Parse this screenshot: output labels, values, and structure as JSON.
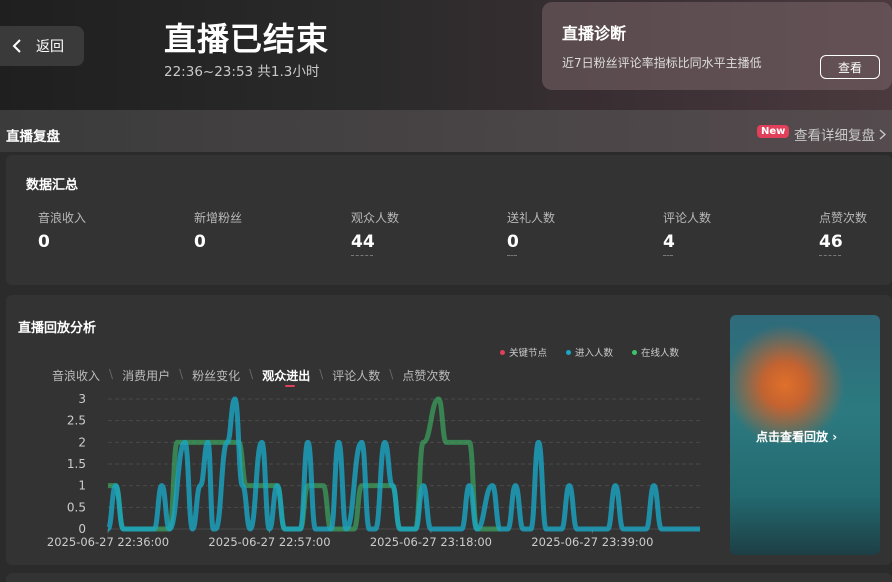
{
  "header": {
    "back_label": "返回",
    "title": "直播已结束",
    "time_range": "22:36~23:53 共1.3小时"
  },
  "diagnosis": {
    "title": "直播诊断",
    "description": "近7日粉丝评论率指标比同水平主播低",
    "button_label": "查看"
  },
  "review": {
    "section_title": "直播复盘",
    "new_badge": "New",
    "detail_link": "查看详细复盘"
  },
  "summary": {
    "title": "数据汇总",
    "stats": [
      {
        "label": "音浪收入",
        "value": "0"
      },
      {
        "label": "新增粉丝",
        "value": "0"
      },
      {
        "label": "观众人数",
        "value": "44"
      },
      {
        "label": "送礼人数",
        "value": "0"
      },
      {
        "label": "评论人数",
        "value": "4"
      },
      {
        "label": "点赞次数",
        "value": "46"
      }
    ]
  },
  "analysis": {
    "title": "直播回放分析",
    "legend": [
      {
        "label": "关键节点",
        "color": "#e0405a"
      },
      {
        "label": "进入人数",
        "color": "#1aa6c4"
      },
      {
        "label": "在线人数",
        "color": "#3ec36b"
      }
    ],
    "tabs": [
      "音浪收入",
      "消费用户",
      "粉丝变化",
      "观众进出",
      "评论人数",
      "点赞次数"
    ],
    "active_tab": "观众进出",
    "replay_label": "点击查看回放"
  },
  "chart_data": {
    "type": "line",
    "ylim": [
      0,
      3
    ],
    "yticks": [
      "0",
      "0.5",
      "1",
      "1.5",
      "2",
      "2.5",
      "3"
    ],
    "xticks": [
      "2025-06-27 22:36:00",
      "2025-06-27 22:57:00",
      "2025-06-27 23:18:00",
      "2025-06-27 23:39:00"
    ],
    "x_range_minutes": [
      0,
      77
    ],
    "series": [
      {
        "name": "进入人数",
        "color": "#1aa6c4",
        "points": [
          [
            0,
            0
          ],
          [
            1,
            1
          ],
          [
            2,
            0
          ],
          [
            6,
            0
          ],
          [
            7,
            1
          ],
          [
            8,
            0
          ],
          [
            10,
            2
          ],
          [
            11,
            0
          ],
          [
            12,
            1
          ],
          [
            13,
            2
          ],
          [
            13.7,
            0
          ],
          [
            14,
            0
          ],
          [
            15.5,
            2
          ],
          [
            16.5,
            3
          ],
          [
            17.5,
            1
          ],
          [
            18.5,
            0
          ],
          [
            20,
            2
          ],
          [
            21,
            0
          ],
          [
            22,
            1
          ],
          [
            23,
            0
          ],
          [
            25,
            0
          ],
          [
            26,
            2
          ],
          [
            27,
            0
          ],
          [
            29,
            0
          ],
          [
            30,
            2
          ],
          [
            31,
            0
          ],
          [
            33,
            2
          ],
          [
            34,
            0
          ],
          [
            34.8,
            0
          ],
          [
            36,
            2
          ],
          [
            37,
            1
          ],
          [
            38,
            0
          ],
          [
            40,
            0
          ],
          [
            41,
            1
          ],
          [
            42,
            0
          ],
          [
            46,
            0
          ],
          [
            47,
            1
          ],
          [
            48,
            0
          ],
          [
            50,
            1
          ],
          [
            51,
            0
          ],
          [
            52,
            0
          ],
          [
            53,
            1
          ],
          [
            54,
            0
          ],
          [
            55,
            0
          ],
          [
            56,
            2
          ],
          [
            57,
            0
          ],
          [
            59,
            0
          ],
          [
            60,
            1
          ],
          [
            61,
            0
          ],
          [
            65,
            0
          ],
          [
            66,
            1
          ],
          [
            67,
            0
          ],
          [
            70,
            0
          ],
          [
            71,
            1
          ],
          [
            72,
            0
          ],
          [
            76,
            0
          ],
          [
            77,
            0
          ]
        ]
      },
      {
        "name": "在线人数",
        "color": "#3ec36b",
        "points": [
          [
            0,
            1
          ],
          [
            1,
            1
          ],
          [
            2,
            0
          ],
          [
            8,
            0
          ],
          [
            9,
            2
          ],
          [
            12,
            2
          ],
          [
            13,
            2
          ],
          [
            14,
            2
          ],
          [
            15,
            2
          ],
          [
            16,
            2
          ],
          [
            17,
            2
          ],
          [
            18,
            1
          ],
          [
            20,
            1
          ],
          [
            22,
            1
          ],
          [
            23,
            0
          ],
          [
            25,
            0
          ],
          [
            26,
            1
          ],
          [
            28,
            1
          ],
          [
            29,
            0
          ],
          [
            32,
            0
          ],
          [
            33,
            1
          ],
          [
            36,
            1
          ],
          [
            37,
            1
          ],
          [
            38,
            0
          ],
          [
            40,
            0
          ],
          [
            41,
            2
          ],
          [
            43,
            3
          ],
          [
            44,
            2
          ],
          [
            47,
            2
          ],
          [
            48,
            0
          ],
          [
            50,
            0
          ],
          [
            51,
            0
          ]
        ]
      }
    ],
    "annotations": []
  }
}
